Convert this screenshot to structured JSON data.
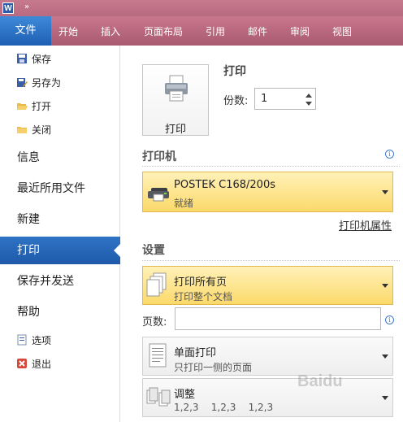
{
  "app": {
    "badge": "W",
    "qat_more": "»"
  },
  "ribbon": {
    "file_tab": "文件",
    "tabs": [
      "开始",
      "插入",
      "页面布局",
      "引用",
      "邮件",
      "审阅",
      "视图"
    ]
  },
  "sidebar": {
    "small_items": [
      {
        "label": "保存",
        "icon": "save-icon"
      },
      {
        "label": "另存为",
        "icon": "save-as-icon"
      },
      {
        "label": "打开",
        "icon": "open-folder-icon"
      },
      {
        "label": "关闭",
        "icon": "close-folder-icon"
      }
    ],
    "big_items": [
      {
        "label": "信息"
      },
      {
        "label": "最近所用文件"
      },
      {
        "label": "新建"
      },
      {
        "label": "打印",
        "active": true
      },
      {
        "label": "保存并发送"
      },
      {
        "label": "帮助"
      }
    ],
    "bottom_items": [
      {
        "label": "选项",
        "icon": "options-icon"
      },
      {
        "label": "退出",
        "icon": "exit-icon"
      }
    ]
  },
  "print": {
    "button_label": "打印",
    "heading": "打印",
    "copies_label": "份数:",
    "copies_value": "1"
  },
  "printer": {
    "section_title": "打印机",
    "name": "POSTEK C168/200s",
    "status": "就绪",
    "properties_link": "打印机属性"
  },
  "settings": {
    "section_title": "设置",
    "range_main": "打印所有页",
    "range_sub": "打印整个文档",
    "pages_label": "页数:",
    "pages_value": "",
    "sides_main": "单面打印",
    "sides_sub": "只打印一侧的页面",
    "collate_main": "调整",
    "collate_sub": "1,2,3    1,2,3    1,2,3"
  },
  "watermark": "Baidu",
  "colors": {
    "ribbon": "#b76a80",
    "file_tab": "#1d5fb5",
    "active_nav": "#2a6abf",
    "highlight": "#fbd96a"
  }
}
